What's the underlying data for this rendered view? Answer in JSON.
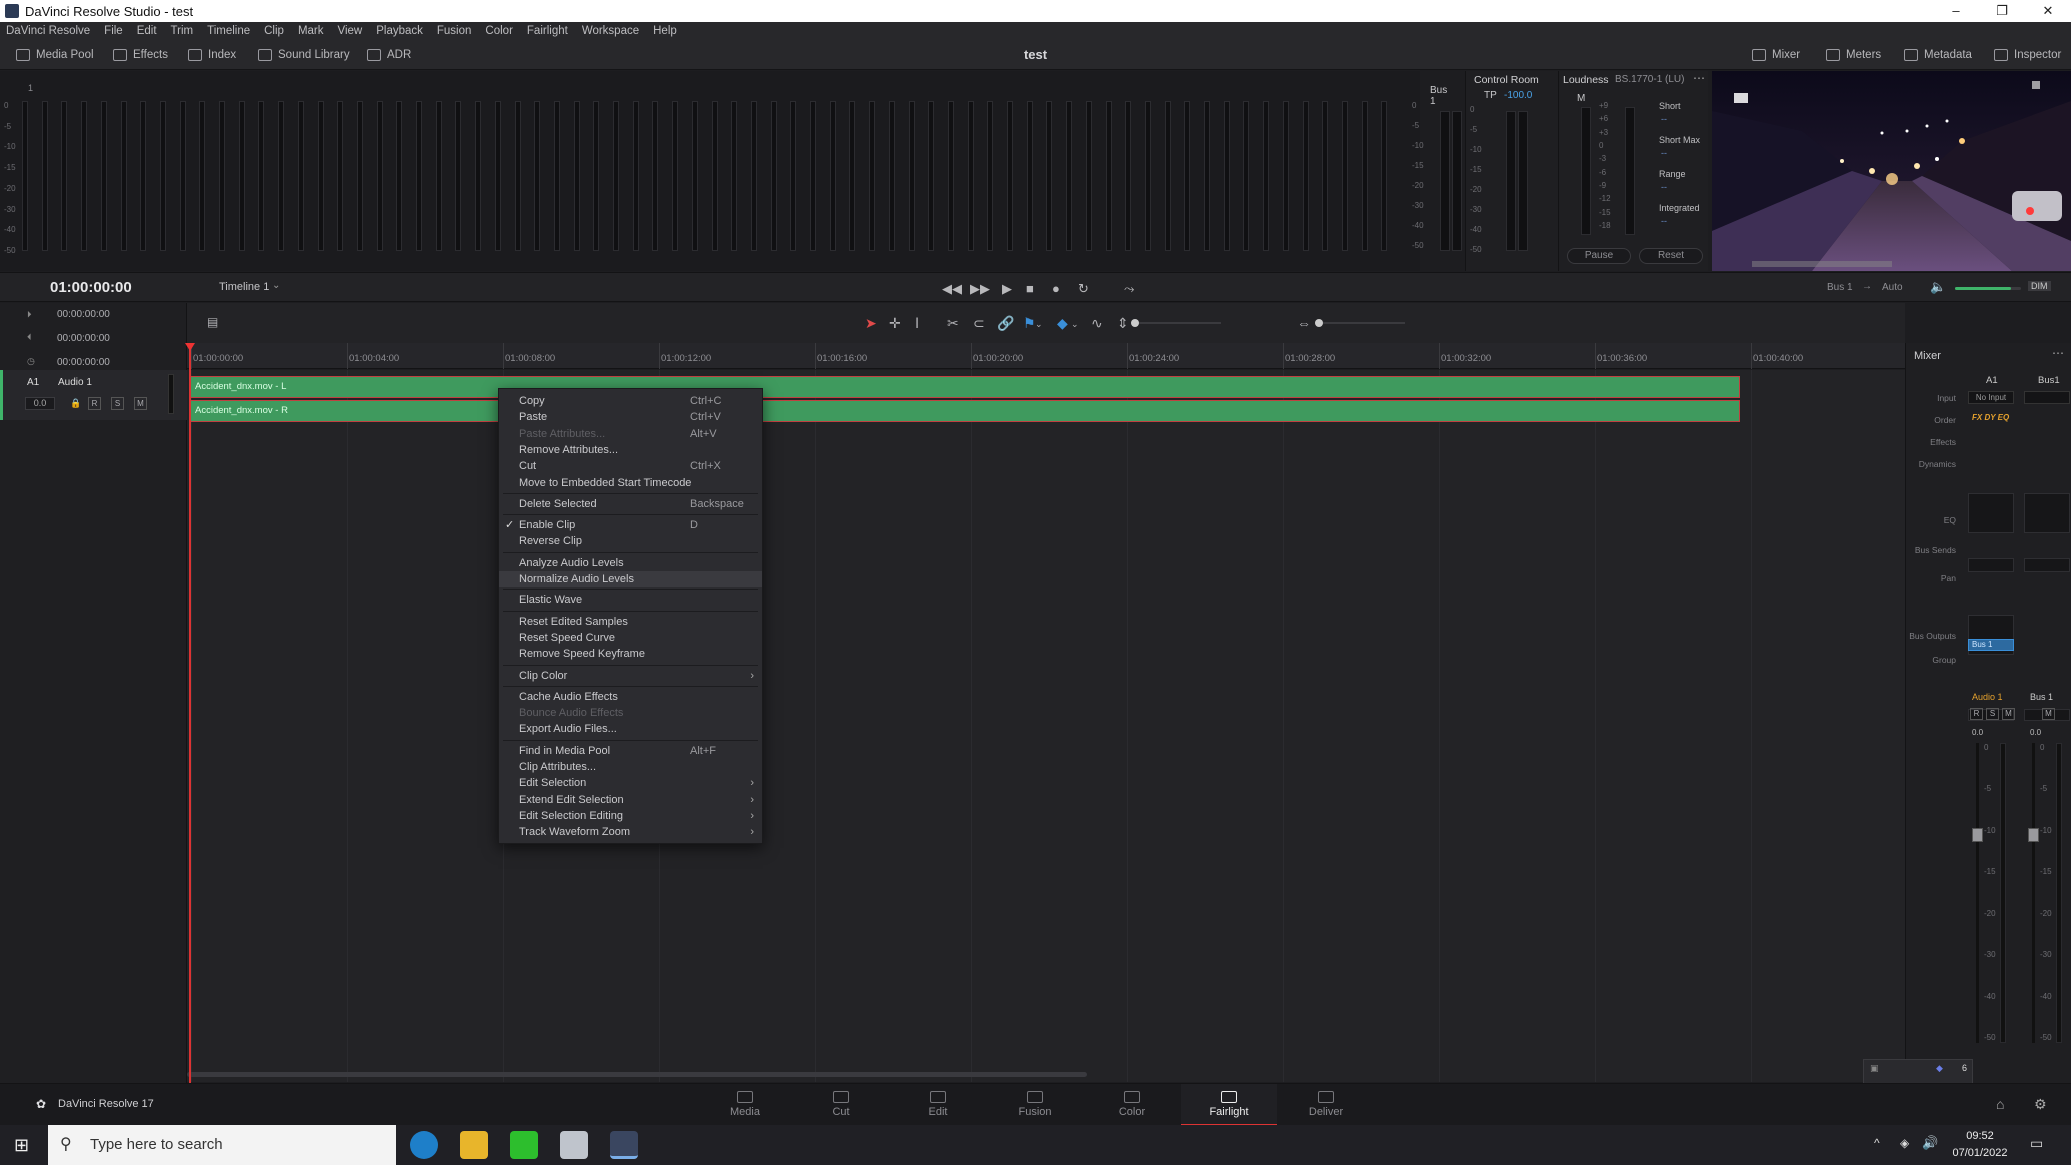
{
  "window": {
    "title": "DaVinci Resolve Studio - test",
    "controls": [
      "–",
      "❐",
      "✕"
    ]
  },
  "menu": [
    "DaVinci Resolve",
    "File",
    "Edit",
    "Trim",
    "Timeline",
    "Clip",
    "Mark",
    "View",
    "Playback",
    "Fusion",
    "Color",
    "Fairlight",
    "Workspace",
    "Help"
  ],
  "toolbar": {
    "left": [
      {
        "label": "Media Pool",
        "icon": "media-pool-icon"
      },
      {
        "label": "Effects",
        "icon": "effects-icon"
      },
      {
        "label": "Index",
        "icon": "index-icon"
      },
      {
        "label": "Sound Library",
        "icon": "sound-library-icon"
      },
      {
        "label": "ADR",
        "icon": "adr-icon"
      }
    ],
    "project": "test",
    "right": [
      {
        "label": "Mixer",
        "icon": "mixer-icon"
      },
      {
        "label": "Meters",
        "icon": "meters-icon"
      },
      {
        "label": "Metadata",
        "icon": "metadata-icon"
      },
      {
        "label": "Inspector",
        "icon": "inspector-icon"
      }
    ]
  },
  "meters": {
    "first_channel": "1",
    "scale": [
      "0",
      "-5",
      "-10",
      "-15",
      "-20",
      "-30",
      "-40",
      "-50"
    ],
    "bus_label": "Bus 1",
    "bus_scale": [
      "0",
      "-5",
      "-10",
      "-15",
      "-20",
      "-30",
      "-40",
      "-50"
    ]
  },
  "control_room": {
    "title": "Control Room",
    "tp_label": "TP",
    "tp_value": "-100.0",
    "scale": [
      "0",
      "-5",
      "-10",
      "-15",
      "-20",
      "-30",
      "-40",
      "-50"
    ]
  },
  "loudness": {
    "title": "Loudness",
    "standard": "BS.1770-1 (LU)",
    "m_label": "M",
    "scale": [
      "+9",
      "+6",
      "+3",
      "0",
      "-3",
      "-6",
      "-9",
      "-12",
      "-15",
      "-18"
    ],
    "rows": [
      {
        "label": "Short",
        "value": "--"
      },
      {
        "label": "Short Max",
        "value": "--"
      },
      {
        "label": "Range",
        "value": "--"
      },
      {
        "label": "Integrated",
        "value": "--"
      }
    ],
    "pause": "Pause",
    "reset": "Reset"
  },
  "transport": {
    "timecode": "01:00:00:00",
    "timeline": "Timeline 1",
    "bus_out": "Bus 1",
    "arrow": "→",
    "auto": "Auto",
    "dim": "DIM",
    "volume_fraction": 0.85
  },
  "tc_rows": [
    "00:00:00:00",
    "00:00:00:00",
    "00:00:00:00"
  ],
  "track": {
    "id": "A1",
    "name": "Audio 1",
    "level": "0.0",
    "buttons": [
      "R",
      "S",
      "M"
    ]
  },
  "ruler": [
    "01:00:00:00",
    "01:00:04:00",
    "01:00:08:00",
    "01:00:12:00",
    "01:00:16:00",
    "01:00:20:00",
    "01:00:24:00",
    "01:00:28:00",
    "01:00:32:00",
    "01:00:36:00",
    "01:00:40:00"
  ],
  "clips": [
    "Accident_dnx.mov - L",
    "Accident_dnx.mov - R"
  ],
  "context_menu": [
    {
      "label": "Copy",
      "shortcut": "Ctrl+C"
    },
    {
      "label": "Paste",
      "shortcut": "Ctrl+V"
    },
    {
      "label": "Paste Attributes...",
      "shortcut": "Alt+V",
      "disabled": true
    },
    {
      "label": "Remove Attributes..."
    },
    {
      "label": "Cut",
      "shortcut": "Ctrl+X"
    },
    {
      "label": "Move to Embedded Start Timecode"
    },
    {
      "sep": true
    },
    {
      "label": "Delete Selected",
      "shortcut": "Backspace"
    },
    {
      "sep": true
    },
    {
      "label": "Enable Clip",
      "shortcut": "D",
      "checked": true
    },
    {
      "label": "Reverse Clip"
    },
    {
      "sep": true
    },
    {
      "label": "Analyze Audio Levels"
    },
    {
      "label": "Normalize Audio Levels",
      "highlight": true
    },
    {
      "sep": true
    },
    {
      "label": "Elastic Wave"
    },
    {
      "sep": true
    },
    {
      "label": "Reset Edited Samples"
    },
    {
      "label": "Reset Speed Curve"
    },
    {
      "label": "Remove Speed Keyframe"
    },
    {
      "sep": true
    },
    {
      "label": "Clip Color",
      "submenu": true
    },
    {
      "sep": true
    },
    {
      "label": "Cache Audio Effects"
    },
    {
      "label": "Bounce Audio Effects",
      "disabled": true
    },
    {
      "label": "Export Audio Files..."
    },
    {
      "sep": true
    },
    {
      "label": "Find in Media Pool",
      "shortcut": "Alt+F"
    },
    {
      "label": "Clip Attributes..."
    },
    {
      "label": "Edit Selection",
      "submenu": true
    },
    {
      "label": "Extend Edit Selection",
      "submenu": true
    },
    {
      "label": "Edit Selection Editing",
      "submenu": true
    },
    {
      "label": "Track Waveform Zoom",
      "submenu": true
    }
  ],
  "mixer": {
    "title": "Mixer",
    "strips": [
      "A1",
      "Bus1"
    ],
    "rows": [
      "Input",
      "Order",
      "Effects",
      "Dynamics",
      "EQ",
      "Bus Sends",
      "Pan",
      "Bus Outputs",
      "Group"
    ],
    "input_value": "No Input",
    "order_value": "FX DY EQ",
    "bus_output": "Bus 1",
    "strip_names": [
      "Audio 1",
      "Bus 1"
    ],
    "strip1_buttons": [
      "R",
      "S",
      "M"
    ],
    "strip2_buttons": [
      "M"
    ],
    "levels": [
      "0.0",
      "0.0"
    ],
    "fader_scale": [
      "0",
      "-5",
      "-10",
      "-15",
      "-20",
      "-30",
      "-40",
      "-50"
    ],
    "counter": "6"
  },
  "pagebar": {
    "brand": "DaVinci Resolve 17",
    "pages": [
      "Media",
      "Cut",
      "Edit",
      "Fusion",
      "Color",
      "Fairlight",
      "Deliver"
    ],
    "active": "Fairlight"
  },
  "taskbar": {
    "search_placeholder": "Type here to search",
    "time": "09:52",
    "date": "07/01/2022"
  },
  "colors": {
    "clip": "#3f9a5e",
    "clip_border": "#c04040",
    "playhead": "#dd3333",
    "accent": "#3a8fd9"
  }
}
